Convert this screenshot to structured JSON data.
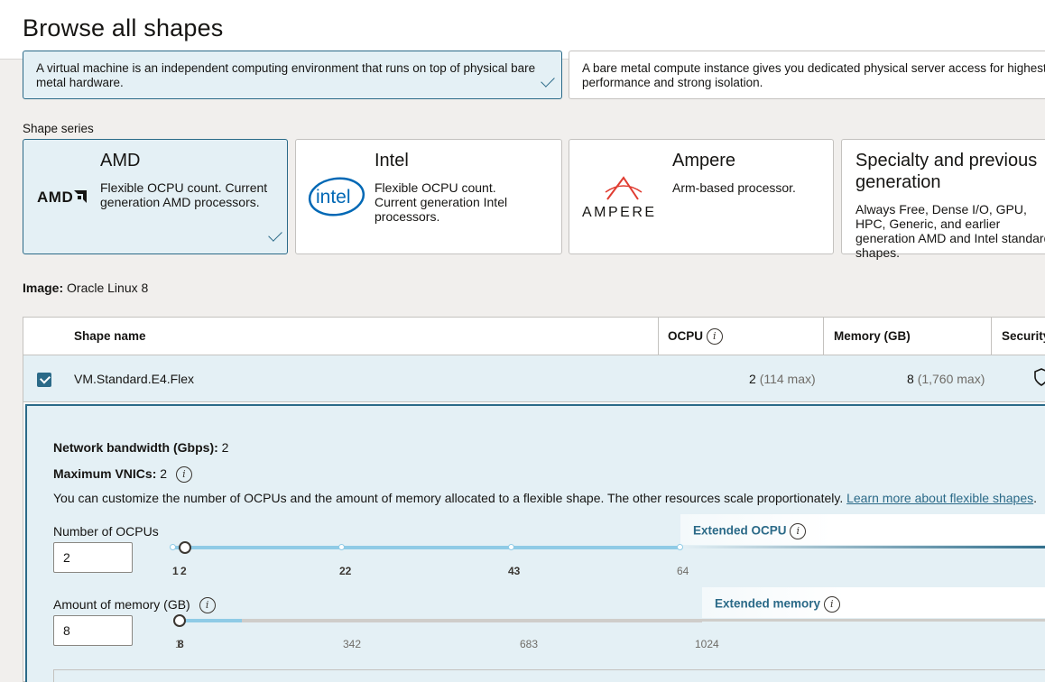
{
  "header": {
    "title": "Browse all shapes"
  },
  "instance_types": [
    {
      "description": "A virtual machine is an independent computing environment that runs on top of physical bare metal hardware.",
      "selected": true
    },
    {
      "description": "A bare metal compute instance gives you dedicated physical server access for highest performance and strong isolation.",
      "selected": false
    }
  ],
  "shape_series": {
    "label": "Shape series",
    "cards": [
      {
        "title": "AMD",
        "logo": "AMD",
        "description": "Flexible OCPU count. Current generation AMD processors.",
        "selected": true
      },
      {
        "title": "Intel",
        "logo": "intel",
        "description": "Flexible OCPU count. Current generation Intel processors.",
        "selected": false
      },
      {
        "title": "Ampere",
        "logo": "AMPERE",
        "description": "Arm-based processor.",
        "selected": false
      },
      {
        "title": "Specialty and previous generation",
        "description": "Always Free, Dense I/O, GPU, HPC, Generic, and earlier generation AMD and Intel standard shapes.",
        "selected": false
      }
    ]
  },
  "image": {
    "label": "Image:",
    "value": "Oracle Linux 8"
  },
  "table": {
    "columns": [
      "Shape name",
      "OCPU",
      "Memory (GB)",
      "Security"
    ],
    "rows": [
      {
        "name": "VM.Standard.E4.Flex",
        "ocpu": "2",
        "ocpu_max": "(114 max)",
        "memory": "8",
        "memory_max": "(1,760 max)",
        "selected": true
      }
    ]
  },
  "detail": {
    "bandwidth_label": "Network bandwidth (Gbps):",
    "bandwidth_value": "2",
    "vnics_label": "Maximum VNICs:",
    "vnics_value": "2",
    "customize_text": "You can customize the number of OCPUs and the amount of memory allocated to a flexible shape. The other resources scale proportionately.",
    "learn_more": "Learn more about flexible shapes",
    "learn_more_suffix": ".",
    "ocpu": {
      "label": "Number of OCPUs",
      "value": "2",
      "ticks": [
        "1",
        "2",
        "22",
        "43",
        "64"
      ],
      "extended_label": "Extended OCPU"
    },
    "memory": {
      "label": "Amount of memory (GB)",
      "value": "8",
      "ticks": [
        "1",
        "8",
        "342",
        "683",
        "1024"
      ],
      "extended_label": "Extended memory"
    }
  },
  "colors": {
    "accent": "#2b6a88",
    "selected_bg": "#e4f0f5",
    "slider_fill": "#8fcbe6",
    "amp_red": "#e03c31",
    "intel_blue": "#0068b5"
  }
}
